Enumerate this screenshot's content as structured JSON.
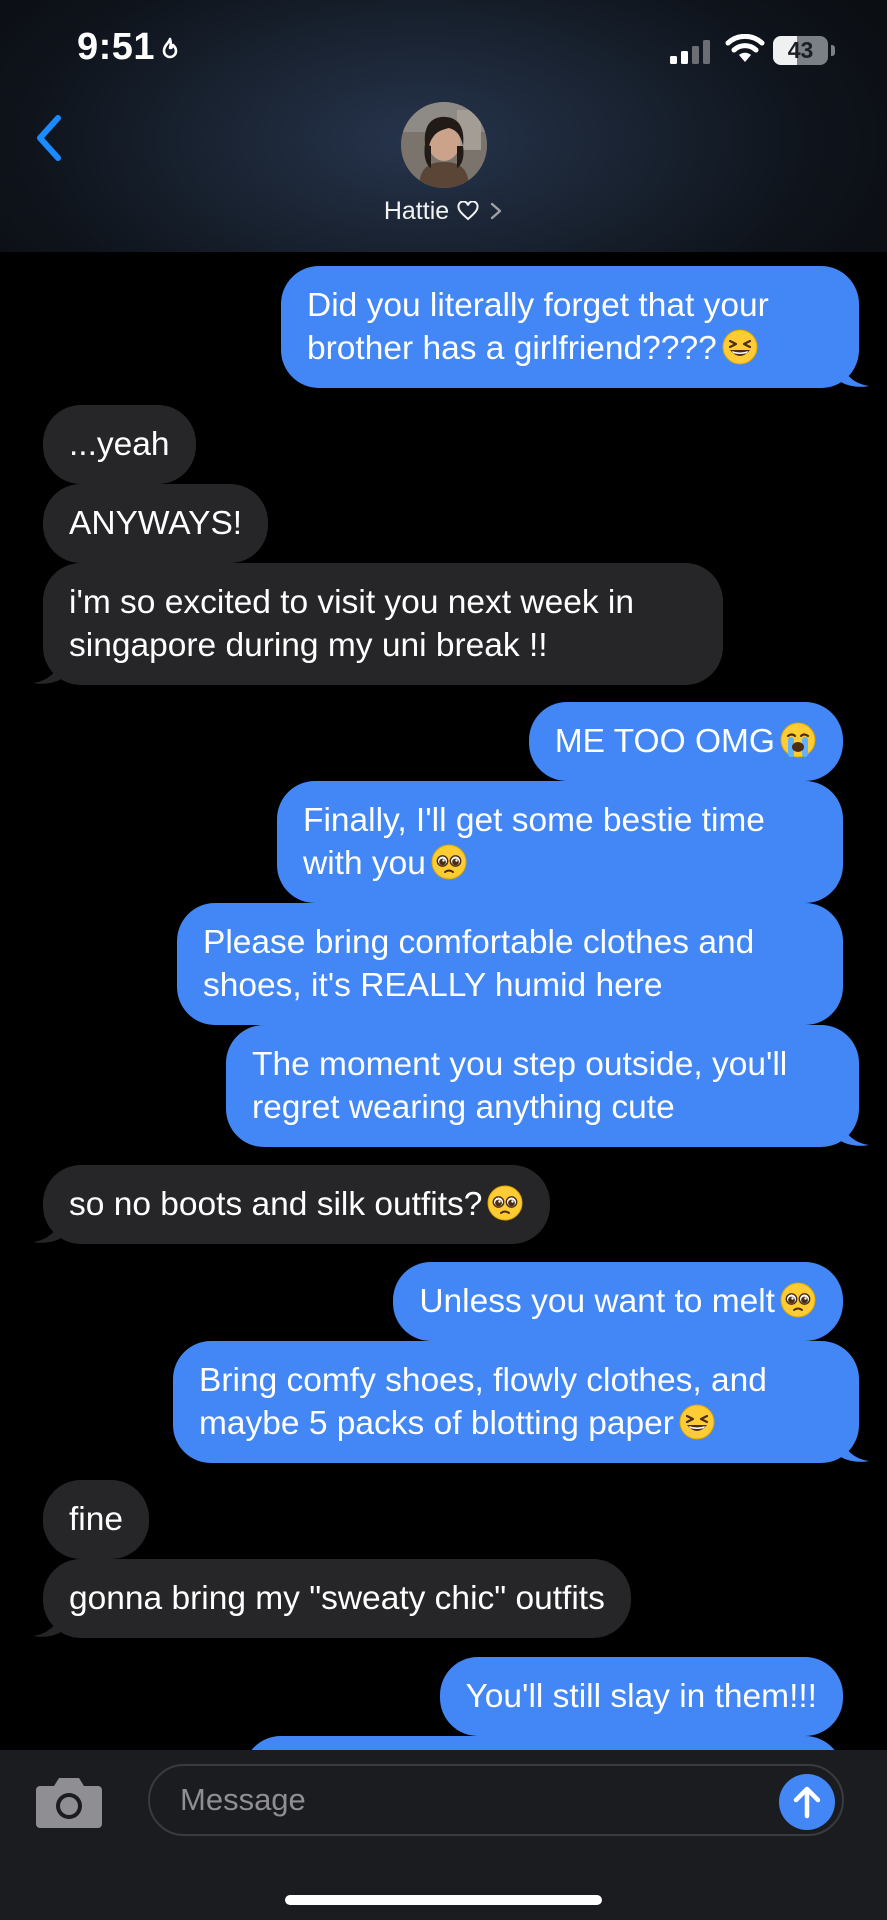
{
  "status_bar": {
    "time": "9:51",
    "battery_level": "43",
    "battery_fraction": 0.43
  },
  "header": {
    "contact_name": "Hattie"
  },
  "messages": [
    {
      "side": "sent",
      "text": "Did you literally forget that your\nbrother has a girlfriend????",
      "emoji": "grinning-squinting-face"
    },
    {
      "side": "recv",
      "text": "...yeah",
      "emoji": null
    },
    {
      "side": "recv",
      "text": "ANYWAYS!",
      "emoji": null
    },
    {
      "side": "recv",
      "text": "i'm so excited to visit you next week in\nsingapore during my uni break !!",
      "emoji": null
    },
    {
      "side": "sent",
      "text": "ME TOO OMG",
      "emoji": "loudly-crying-face"
    },
    {
      "side": "sent",
      "text": "Finally, I'll get some bestie time\nwith you",
      "emoji": "pleading-face"
    },
    {
      "side": "sent",
      "text": "Please bring comfortable clothes and\nshoes, it's REALLY humid here",
      "emoji": null
    },
    {
      "side": "sent",
      "text": "The moment you step outside, you'll\nregret wearing anything cute",
      "emoji": null
    },
    {
      "side": "recv",
      "text": "so no boots and silk outfits?",
      "emoji": "pleading-face"
    },
    {
      "side": "sent",
      "text": "Unless you want to melt",
      "emoji": "pleading-face"
    },
    {
      "side": "sent",
      "text": "Bring comfy shoes, flowly clothes, and\nmaybe 5 packs of blotting paper",
      "emoji": "grinning-squinting-face"
    },
    {
      "side": "recv",
      "text": "fine",
      "emoji": null
    },
    {
      "side": "recv",
      "text": "gonna bring my \"sweaty chic\" outfits",
      "emoji": null
    },
    {
      "side": "sent",
      "text": "You'll still slay in them!!!",
      "emoji": null
    },
    {
      "side": "sent",
      "text": "",
      "emoji": null
    }
  ],
  "compose": {
    "placeholder": "Message"
  },
  "colors": {
    "sent_bubble": "#4287f5",
    "received_bubble": "#262628",
    "accent": "#0a84ff"
  }
}
